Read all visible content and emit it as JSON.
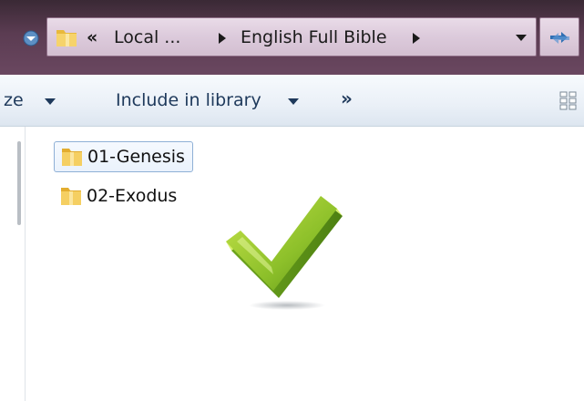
{
  "address": {
    "overflow_chevron": "«",
    "crumbs": [
      "Local ...",
      "English Full Bible"
    ]
  },
  "toolbar": {
    "organize_label": "ze",
    "include_label": "Include in library",
    "more_label": "»"
  },
  "files": [
    {
      "name": "01-Genesis"
    },
    {
      "name": "02-Exodus"
    }
  ],
  "icons": {
    "folder": "folder-icon",
    "refresh": "refresh-icon",
    "checkmark": "checkmark-icon",
    "view": "view-options-icon"
  },
  "colors": {
    "title_bar": "#5b3c52",
    "toolbar_text": "#1e395b",
    "folder_yellow": "#f2c94c",
    "checkmark_green": "#8dc02a",
    "selection_border": "#8fb0d6"
  }
}
